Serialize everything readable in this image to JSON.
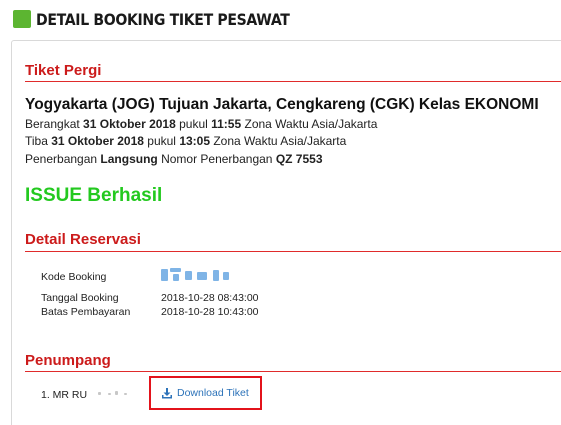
{
  "header": {
    "title": "DETAIL BOOKING TIKET PESAWAT",
    "accent": "#5cb531"
  },
  "tiket_pergi": {
    "title": "Tiket Pergi",
    "route": "Yogyakarta (JOG) Tujuan Jakarta, Cengkareng (CGK) Kelas EKONOMI",
    "depart": {
      "p1": "Berangkat ",
      "date": "31 Oktober 2018",
      "p2": " pukul ",
      "time": "11:55",
      "p3": " Zona Waktu Asia/Jakarta"
    },
    "arrive": {
      "p1": "Tiba ",
      "date": "31 Oktober 2018",
      "p2": " pukul ",
      "time": "13:05",
      "p3": " Zona Waktu Asia/Jakarta"
    },
    "flight": {
      "p1": "Penerbangan ",
      "type": "Langsung",
      "p2": " Nomor Penerbangan ",
      "number": "QZ 7553"
    }
  },
  "status": {
    "text": "ISSUE Berhasil",
    "color": "#23c91f"
  },
  "reservasi": {
    "title": "Detail Reservasi",
    "kode_label": "Kode Booking",
    "tanggal_label": "Tanggal Booking",
    "tanggal_value": "2018-10-28 08:43:00",
    "batas_label": "Batas Pembayaran",
    "batas_value": "2018-10-28 10:43:00"
  },
  "penumpang": {
    "title": "Penumpang",
    "item_text": "1. MR RU",
    "download_label": "Download Tiket",
    "download_icon": "download-icon"
  },
  "colors": {
    "section_title": "#cc1b1b",
    "highlight_box": "#e3131b",
    "link": "#2d73b9"
  }
}
